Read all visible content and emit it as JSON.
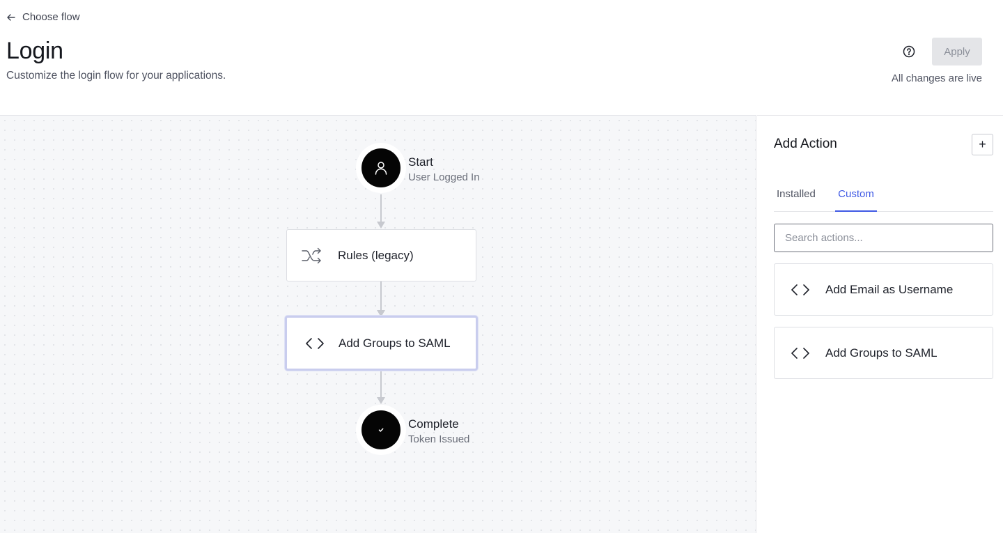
{
  "header": {
    "back_label": "Choose flow",
    "title": "Login",
    "subtitle": "Customize the login flow for your applications.",
    "apply_label": "Apply",
    "status": "All changes are live"
  },
  "flow": {
    "start": {
      "title": "Start",
      "subtitle": "User Logged In",
      "icon": "user-icon"
    },
    "nodes": [
      {
        "label": "Rules (legacy)",
        "icon": "shuffle-icon",
        "selected": false
      },
      {
        "label": "Add Groups to SAML",
        "icon": "code-icon",
        "selected": true
      }
    ],
    "end": {
      "title": "Complete",
      "subtitle": "Token Issued",
      "icon": "check-icon"
    }
  },
  "panel": {
    "title": "Add Action",
    "add_label": "+",
    "tabs": [
      {
        "label": "Installed",
        "active": false
      },
      {
        "label": "Custom",
        "active": true
      }
    ],
    "search_placeholder": "Search actions...",
    "actions": [
      {
        "label": "Add Email as Username",
        "icon": "code-icon"
      },
      {
        "label": "Add Groups to SAML",
        "icon": "code-icon"
      }
    ]
  },
  "colors": {
    "accent": "#3f59e4",
    "node_fill": "#050505",
    "canvas_bg": "#f6f7f9",
    "selected_border": "#c9cdee"
  }
}
